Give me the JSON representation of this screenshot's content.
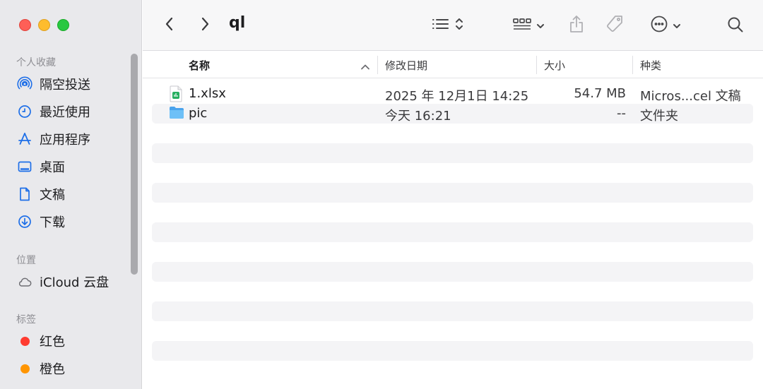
{
  "window": {
    "folder_title": "ql"
  },
  "sidebar": {
    "favorites_label": "个人收藏",
    "favorites": [
      {
        "label": "隔空投送",
        "icon": "airdrop-icon"
      },
      {
        "label": "最近使用",
        "icon": "clock-icon"
      },
      {
        "label": "应用程序",
        "icon": "applications-icon"
      },
      {
        "label": "桌面",
        "icon": "desktop-icon"
      },
      {
        "label": "文稿",
        "icon": "document-icon"
      },
      {
        "label": "下载",
        "icon": "download-icon"
      }
    ],
    "locations_label": "位置",
    "locations": [
      {
        "label": "iCloud 云盘",
        "icon": "cloud-icon"
      }
    ],
    "tags_label": "标签",
    "tags": [
      {
        "label": "红色",
        "color": "#ff3b30"
      },
      {
        "label": "橙色",
        "color": "#ff9500"
      }
    ]
  },
  "columns": {
    "name": "名称",
    "date": "修改日期",
    "size": "大小",
    "kind": "种类"
  },
  "files": [
    {
      "name": "1.xlsx",
      "date": "2025 年 12月1日 14:25",
      "size": "54.7 MB",
      "kind": "Micros...cel 文稿",
      "icon": "excel-file-icon"
    },
    {
      "name": "pic",
      "date": "今天 16:21",
      "size": "--",
      "kind": "文件夹",
      "icon": "folder-icon"
    }
  ],
  "colors": {
    "accent": "#1e6fe8",
    "folder": "#5ab0f2"
  }
}
